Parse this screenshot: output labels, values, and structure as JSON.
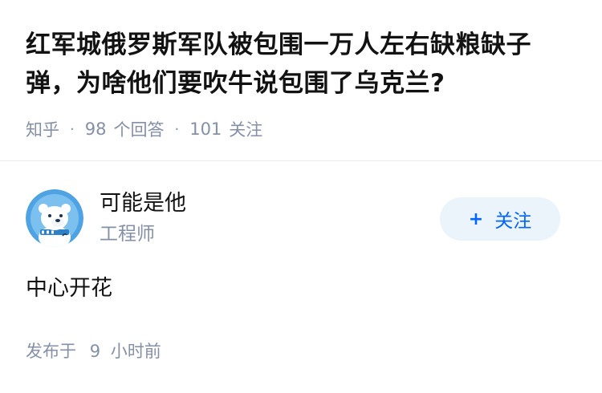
{
  "question": {
    "title": "红军城俄罗斯军队被包围一万人左右缺粮缺子弹，为啥他们要吹牛说包围了乌克兰?",
    "source": "知乎",
    "answer_count": "98",
    "answer_label": "个回答",
    "follower_count": "101",
    "follower_label": "关注",
    "separator": "·"
  },
  "author": {
    "avatar_icon": "polar-bear-avatar-icon",
    "name": "可能是他",
    "title": "工程师"
  },
  "follow_button": {
    "icon": "+",
    "label": "关注"
  },
  "answer": {
    "content": "中心开花",
    "published_label": "发布于",
    "published_value": "9",
    "published_unit": "小时前"
  },
  "colors": {
    "accent": "#0066ff",
    "follow_bg": "#ebf3fb",
    "muted_text": "#8590a6",
    "primary_text": "#121212"
  }
}
